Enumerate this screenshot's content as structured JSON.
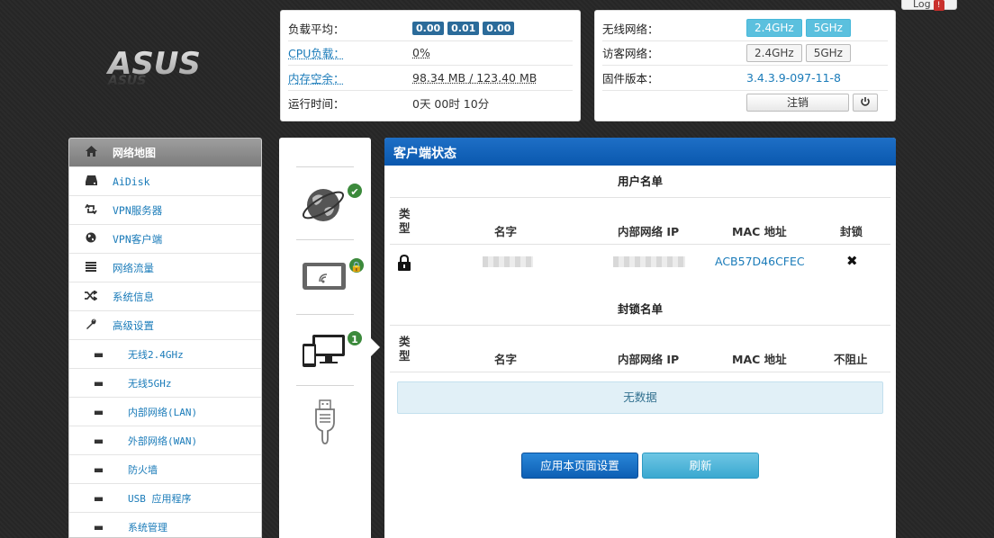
{
  "header": {
    "logout_tab_label": "Log",
    "logo_text": "ASUS"
  },
  "status_left": {
    "load_label": "负载平均：",
    "load_values": [
      "0.00",
      "0.01",
      "0.00"
    ],
    "cpu_label": "CPU负载：",
    "cpu_value": "0%",
    "mem_label": "内存空余：",
    "mem_value": "98.34 MB / 123.40 MB",
    "uptime_label": "运行时间：",
    "uptime_value": "0天 00时 10分"
  },
  "status_right": {
    "wireless_label": "无线网络：",
    "wireless_24": "2.4GHz",
    "wireless_5": "5GHz",
    "guest_label": "访客网络：",
    "guest_24": "2.4GHz",
    "guest_5": "5GHz",
    "firmware_label": "固件版本：",
    "firmware_value": "3.4.3.9-097-11-8",
    "logout_label": "注销"
  },
  "sidebar": {
    "items": [
      {
        "label": "网络地图",
        "icon": "home-icon"
      },
      {
        "label": "AiDisk",
        "icon": "harddisk-icon"
      },
      {
        "label": "VPN服务器",
        "icon": "retweet-icon"
      },
      {
        "label": "VPN客户端",
        "icon": "globe-icon"
      },
      {
        "label": "网络流量",
        "icon": "tasks-icon"
      },
      {
        "label": "系统信息",
        "icon": "random-icon"
      },
      {
        "label": "高级设置",
        "icon": "wrench-icon"
      }
    ],
    "subitems": [
      {
        "label": "无线2.4GHz"
      },
      {
        "label": "无线5GHz"
      },
      {
        "label": "内部网络(LAN)"
      },
      {
        "label": "外部网络(WAN)"
      },
      {
        "label": "防火墙"
      },
      {
        "label": "USB 应用程序"
      },
      {
        "label": "系统管理"
      }
    ]
  },
  "devices": {
    "client_count": "1"
  },
  "main": {
    "title": "客户端状态",
    "user_list": {
      "title": "用户名单",
      "headers": {
        "type": "类型",
        "name": "名字",
        "ip": "内部网络 IP",
        "mac": "MAC 地址",
        "block": "封锁"
      },
      "rows": [
        {
          "mac": "ACB57D46CFEC"
        }
      ]
    },
    "block_list": {
      "title": "封锁名单",
      "headers": {
        "type": "类型",
        "name": "名字",
        "ip": "内部网络 IP",
        "mac": "MAC 地址",
        "unblock": "不阻止"
      },
      "empty_text": "无数据"
    },
    "apply_button": "应用本页面设置",
    "refresh_button": "刷新"
  },
  "colors": {
    "accent_blue": "#0a58ae",
    "link_blue": "#1a7bb9",
    "badge_green": "#3c8a3c",
    "freq_active": "#5bc0de"
  }
}
